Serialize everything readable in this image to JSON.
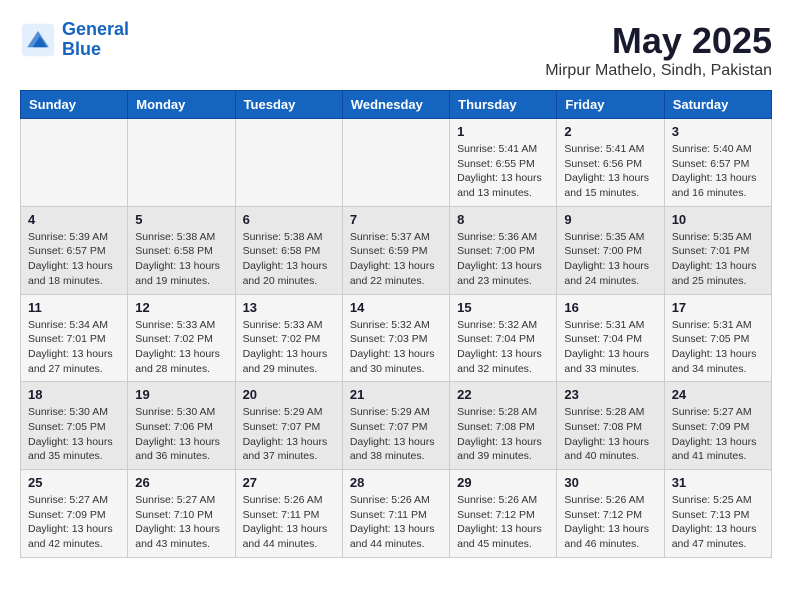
{
  "header": {
    "logo_line1": "General",
    "logo_line2": "Blue",
    "month": "May 2025",
    "location": "Mirpur Mathelo, Sindh, Pakistan"
  },
  "weekdays": [
    "Sunday",
    "Monday",
    "Tuesday",
    "Wednesday",
    "Thursday",
    "Friday",
    "Saturday"
  ],
  "weeks": [
    [
      {
        "day": "",
        "info": ""
      },
      {
        "day": "",
        "info": ""
      },
      {
        "day": "",
        "info": ""
      },
      {
        "day": "",
        "info": ""
      },
      {
        "day": "1",
        "info": "Sunrise: 5:41 AM\nSunset: 6:55 PM\nDaylight: 13 hours\nand 13 minutes."
      },
      {
        "day": "2",
        "info": "Sunrise: 5:41 AM\nSunset: 6:56 PM\nDaylight: 13 hours\nand 15 minutes."
      },
      {
        "day": "3",
        "info": "Sunrise: 5:40 AM\nSunset: 6:57 PM\nDaylight: 13 hours\nand 16 minutes."
      }
    ],
    [
      {
        "day": "4",
        "info": "Sunrise: 5:39 AM\nSunset: 6:57 PM\nDaylight: 13 hours\nand 18 minutes."
      },
      {
        "day": "5",
        "info": "Sunrise: 5:38 AM\nSunset: 6:58 PM\nDaylight: 13 hours\nand 19 minutes."
      },
      {
        "day": "6",
        "info": "Sunrise: 5:38 AM\nSunset: 6:58 PM\nDaylight: 13 hours\nand 20 minutes."
      },
      {
        "day": "7",
        "info": "Sunrise: 5:37 AM\nSunset: 6:59 PM\nDaylight: 13 hours\nand 22 minutes."
      },
      {
        "day": "8",
        "info": "Sunrise: 5:36 AM\nSunset: 7:00 PM\nDaylight: 13 hours\nand 23 minutes."
      },
      {
        "day": "9",
        "info": "Sunrise: 5:35 AM\nSunset: 7:00 PM\nDaylight: 13 hours\nand 24 minutes."
      },
      {
        "day": "10",
        "info": "Sunrise: 5:35 AM\nSunset: 7:01 PM\nDaylight: 13 hours\nand 25 minutes."
      }
    ],
    [
      {
        "day": "11",
        "info": "Sunrise: 5:34 AM\nSunset: 7:01 PM\nDaylight: 13 hours\nand 27 minutes."
      },
      {
        "day": "12",
        "info": "Sunrise: 5:33 AM\nSunset: 7:02 PM\nDaylight: 13 hours\nand 28 minutes."
      },
      {
        "day": "13",
        "info": "Sunrise: 5:33 AM\nSunset: 7:02 PM\nDaylight: 13 hours\nand 29 minutes."
      },
      {
        "day": "14",
        "info": "Sunrise: 5:32 AM\nSunset: 7:03 PM\nDaylight: 13 hours\nand 30 minutes."
      },
      {
        "day": "15",
        "info": "Sunrise: 5:32 AM\nSunset: 7:04 PM\nDaylight: 13 hours\nand 32 minutes."
      },
      {
        "day": "16",
        "info": "Sunrise: 5:31 AM\nSunset: 7:04 PM\nDaylight: 13 hours\nand 33 minutes."
      },
      {
        "day": "17",
        "info": "Sunrise: 5:31 AM\nSunset: 7:05 PM\nDaylight: 13 hours\nand 34 minutes."
      }
    ],
    [
      {
        "day": "18",
        "info": "Sunrise: 5:30 AM\nSunset: 7:05 PM\nDaylight: 13 hours\nand 35 minutes."
      },
      {
        "day": "19",
        "info": "Sunrise: 5:30 AM\nSunset: 7:06 PM\nDaylight: 13 hours\nand 36 minutes."
      },
      {
        "day": "20",
        "info": "Sunrise: 5:29 AM\nSunset: 7:07 PM\nDaylight: 13 hours\nand 37 minutes."
      },
      {
        "day": "21",
        "info": "Sunrise: 5:29 AM\nSunset: 7:07 PM\nDaylight: 13 hours\nand 38 minutes."
      },
      {
        "day": "22",
        "info": "Sunrise: 5:28 AM\nSunset: 7:08 PM\nDaylight: 13 hours\nand 39 minutes."
      },
      {
        "day": "23",
        "info": "Sunrise: 5:28 AM\nSunset: 7:08 PM\nDaylight: 13 hours\nand 40 minutes."
      },
      {
        "day": "24",
        "info": "Sunrise: 5:27 AM\nSunset: 7:09 PM\nDaylight: 13 hours\nand 41 minutes."
      }
    ],
    [
      {
        "day": "25",
        "info": "Sunrise: 5:27 AM\nSunset: 7:09 PM\nDaylight: 13 hours\nand 42 minutes."
      },
      {
        "day": "26",
        "info": "Sunrise: 5:27 AM\nSunset: 7:10 PM\nDaylight: 13 hours\nand 43 minutes."
      },
      {
        "day": "27",
        "info": "Sunrise: 5:26 AM\nSunset: 7:11 PM\nDaylight: 13 hours\nand 44 minutes."
      },
      {
        "day": "28",
        "info": "Sunrise: 5:26 AM\nSunset: 7:11 PM\nDaylight: 13 hours\nand 44 minutes."
      },
      {
        "day": "29",
        "info": "Sunrise: 5:26 AM\nSunset: 7:12 PM\nDaylight: 13 hours\nand 45 minutes."
      },
      {
        "day": "30",
        "info": "Sunrise: 5:26 AM\nSunset: 7:12 PM\nDaylight: 13 hours\nand 46 minutes."
      },
      {
        "day": "31",
        "info": "Sunrise: 5:25 AM\nSunset: 7:13 PM\nDaylight: 13 hours\nand 47 minutes."
      }
    ]
  ]
}
